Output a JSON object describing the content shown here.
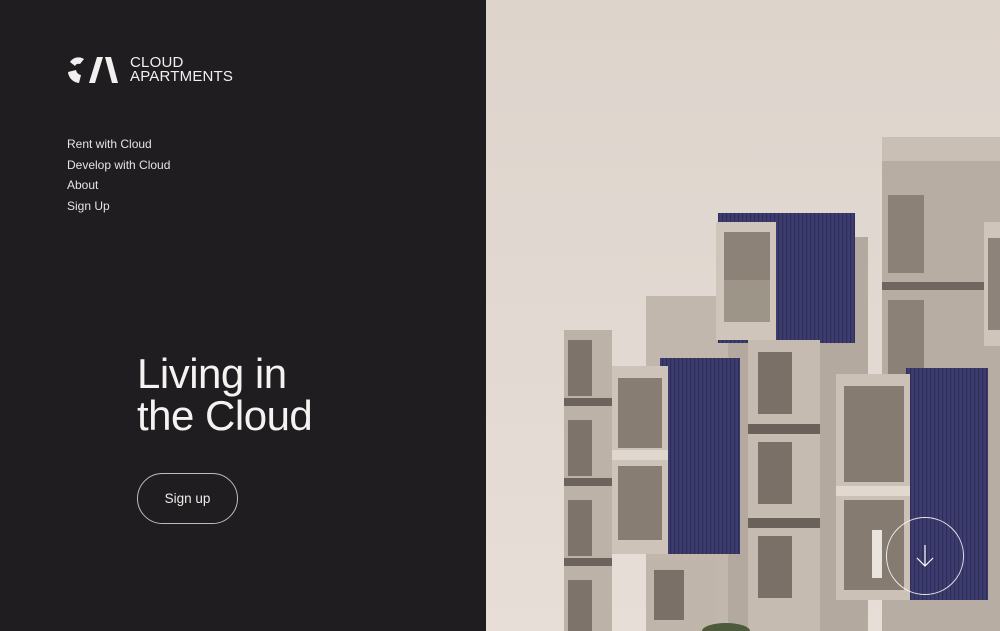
{
  "brand": {
    "line1": "CLOUD",
    "line2": "APARTMENTS"
  },
  "nav": {
    "items": [
      {
        "label": "Rent with Cloud"
      },
      {
        "label": "Develop with Cloud"
      },
      {
        "label": "About"
      },
      {
        "label": "Sign Up"
      }
    ]
  },
  "hero": {
    "line1": "Living in",
    "line2": "the Cloud"
  },
  "cta": {
    "label": "Sign up"
  },
  "icons": {
    "logo": "cloud-logo-icon",
    "scroll": "arrow-down-icon"
  },
  "colors": {
    "background": "#1f1d20",
    "text": "#f5f3f1",
    "accent_panel": "#3b3b6b"
  }
}
